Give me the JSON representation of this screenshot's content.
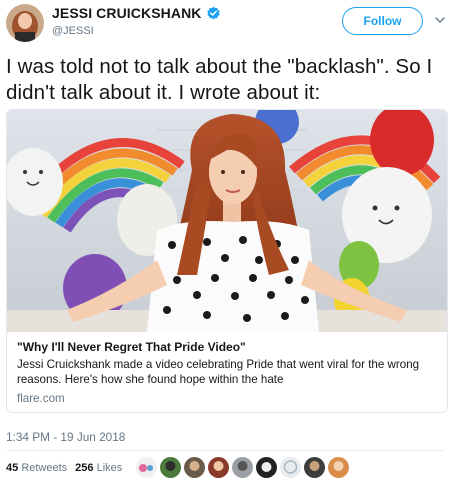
{
  "user": {
    "display_name": "JESSI CRUICKSHANK",
    "handle": "@JESSI",
    "verified_icon": "verified-badge-icon"
  },
  "actions": {
    "follow_label": "Follow",
    "more_icon": "chevron-down-icon"
  },
  "tweet": {
    "text": "I was told not to talk about the \"backlash\". So I didn't talk about it. I wrote about it:",
    "timestamp": "1:34 PM - 19 Jun 2018"
  },
  "card": {
    "title": "\"Why I'll Never Regret That Pride Video\"",
    "description": "Jessi Cruickshank made a video celebrating Pride that went viral for the wrong reasons. Here's how she found hope within the hate",
    "domain": "flare.com"
  },
  "stats": {
    "retweets_count": "45",
    "retweets_label": "Retweets",
    "likes_count": "256",
    "likes_label": "Likes"
  },
  "colors": {
    "accent": "#1da1f2",
    "secondary_text": "#657786",
    "border": "#e1e8ed"
  }
}
